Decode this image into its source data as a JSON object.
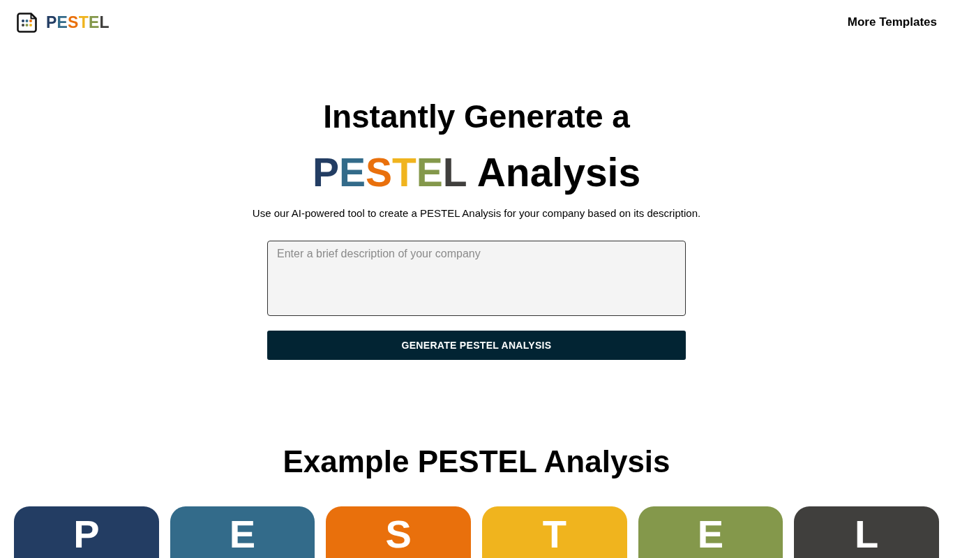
{
  "header": {
    "logo_letters": [
      {
        "char": "P",
        "color": "#233d63"
      },
      {
        "char": "E",
        "color": "#336b8a"
      },
      {
        "char": "S",
        "color": "#e9700c"
      },
      {
        "char": "T",
        "color": "#f0b41e"
      },
      {
        "char": "E",
        "color": "#84984b"
      },
      {
        "char": "L",
        "color": "#403f3d"
      }
    ],
    "nav_link": "More Templates"
  },
  "hero": {
    "title_line_1": "Instantly Generate a",
    "title_letters": [
      {
        "char": "P",
        "color": "#233d63"
      },
      {
        "char": "E",
        "color": "#336b8a"
      },
      {
        "char": "S",
        "color": "#e9700c"
      },
      {
        "char": "T",
        "color": "#f0b41e"
      },
      {
        "char": "E",
        "color": "#84984b"
      },
      {
        "char": "L",
        "color": "#403f3d"
      }
    ],
    "title_rest": "Analysis",
    "subtitle": "Use our AI-powered tool to create a PESTEL Analysis for your company based on its description.",
    "description_field": {
      "placeholder": "Enter a brief description of your company"
    },
    "generate_button": "GENERATE PESTEL ANALYSIS"
  },
  "examples": {
    "title": "Example PESTEL Analysis",
    "cards": [
      {
        "letter": "P",
        "color": "#233d63"
      },
      {
        "letter": "E",
        "color": "#336b8a"
      },
      {
        "letter": "S",
        "color": "#e9700c"
      },
      {
        "letter": "T",
        "color": "#f0b41e"
      },
      {
        "letter": "E",
        "color": "#84984b"
      },
      {
        "letter": "L",
        "color": "#403f3d"
      }
    ]
  }
}
